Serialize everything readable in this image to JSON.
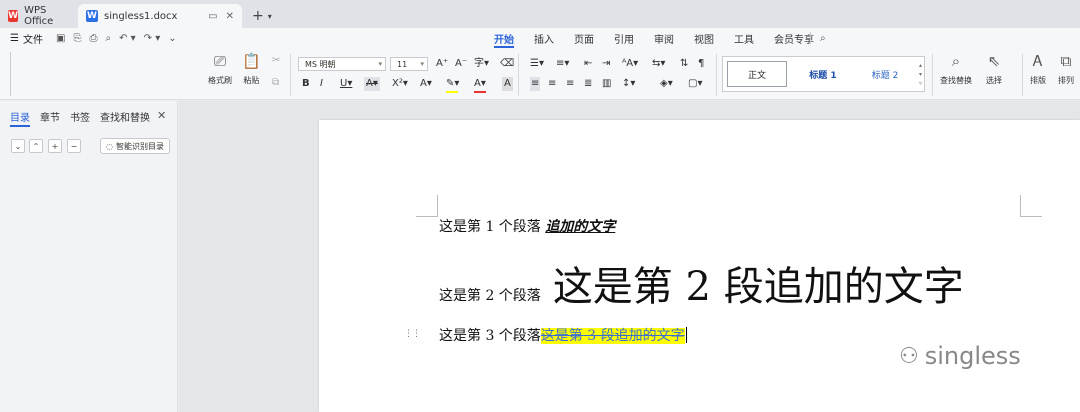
{
  "tabs": {
    "app": "WPS Office",
    "doc": "singless1.docx",
    "doc_icon_letter": "W",
    "app_icon_letter": "W"
  },
  "menu": {
    "file": "文件",
    "tabs": [
      "开始",
      "插入",
      "页面",
      "引用",
      "审阅",
      "视图",
      "工具",
      "会员专享"
    ],
    "active_tab": "开始"
  },
  "ribbon": {
    "format_painter": "格式刷",
    "paste": "粘贴",
    "font_name": "MS 明朝",
    "font_size": "11",
    "styles": [
      "正文",
      "标题 1",
      "标题 2"
    ],
    "find_replace": "查找替换",
    "select": "选择",
    "arrange": "排版",
    "sort": "排列"
  },
  "sidebar": {
    "tabs": [
      "目录",
      "章节",
      "书签",
      "查找和替换"
    ],
    "active_tab": "目录",
    "smart_toc": "智能识别目录"
  },
  "document": {
    "p1_prefix": "这是第 1 个段落",
    "p1_added": "追加的文字",
    "p2_prefix": "这是第 2 个段落",
    "p2_added": "这是第 2 段追加的文字",
    "p3_prefix": "这是第 3 个段落",
    "p3_added": "这是第 3 段追加的文字"
  },
  "watermark": {
    "text": "singless"
  },
  "colors": {
    "accent": "#2b63d9",
    "highlight": "#ffff00",
    "wps_red": "#e8352e",
    "writer_blue": "#2d6fe4"
  }
}
